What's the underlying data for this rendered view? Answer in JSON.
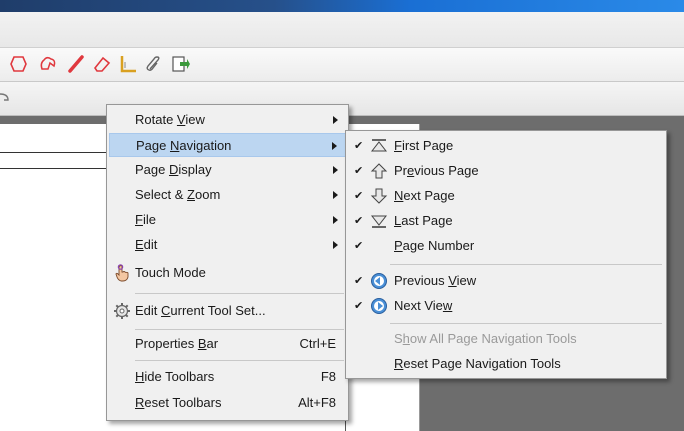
{
  "context_menu": {
    "items": [
      {
        "pre": "Rotate ",
        "ul": "V",
        "post": "iew",
        "has_submenu": true
      },
      {
        "pre": "Page ",
        "ul": "N",
        "post": "avigation",
        "has_submenu": true,
        "highlighted": true
      },
      {
        "pre": "Page ",
        "ul": "D",
        "post": "isplay",
        "has_submenu": true
      },
      {
        "pre": "Select & ",
        "ul": "Z",
        "post": "oom",
        "has_submenu": true
      },
      {
        "pre": "",
        "ul": "F",
        "post": "ile",
        "has_submenu": true
      },
      {
        "pre": "",
        "ul": "E",
        "post": "dit",
        "has_submenu": true
      },
      {
        "pre": "Touch Mode",
        "ul": "",
        "post": "",
        "icon": "touch-hand-icon"
      },
      {
        "pre": "Edit ",
        "ul": "C",
        "post": "urrent Tool Set...",
        "icon": "gear-icon"
      },
      {
        "pre": "Properties ",
        "ul": "B",
        "post": "ar",
        "shortcut": "Ctrl+E"
      },
      {
        "pre": "",
        "ul": "H",
        "post": "ide Toolbars",
        "shortcut": "F8"
      },
      {
        "pre": "",
        "ul": "R",
        "post": "eset Toolbars",
        "shortcut": "Alt+F8"
      }
    ]
  },
  "submenu": {
    "items": [
      {
        "pre": "",
        "ul": "F",
        "post": "irst Page",
        "checked": true,
        "icon": "first-page-icon"
      },
      {
        "pre": "Pr",
        "ul": "e",
        "post": "vious Page",
        "checked": true,
        "icon": "previous-page-icon"
      },
      {
        "pre": "",
        "ul": "N",
        "post": "ext Page",
        "checked": true,
        "icon": "next-page-icon"
      },
      {
        "pre": "",
        "ul": "L",
        "post": "ast Page",
        "checked": true,
        "icon": "last-page-icon"
      },
      {
        "pre": "",
        "ul": "P",
        "post": "age Number",
        "checked": true,
        "icon": ""
      },
      {
        "pre": "Previous ",
        "ul": "V",
        "post": "iew",
        "checked": true,
        "icon": "previous-view-icon"
      },
      {
        "pre": "Next Vie",
        "ul": "w",
        "post": "",
        "checked": true,
        "icon": "next-view-icon"
      },
      {
        "pre": "S",
        "ul": "h",
        "post": "ow All Page Navigation Tools",
        "checked": false,
        "disabled": true
      },
      {
        "pre": "",
        "ul": "R",
        "post": "eset Page Navigation Tools",
        "checked": false
      }
    ]
  },
  "check_mark": "✔",
  "colors": {
    "highlight": "#bcd6f1",
    "menu_bg": "#f0f0f0",
    "workspace": "#6d6d6d",
    "toolbar_icon_red": "#e0383e",
    "disabled_text": "#9a9a9a"
  }
}
